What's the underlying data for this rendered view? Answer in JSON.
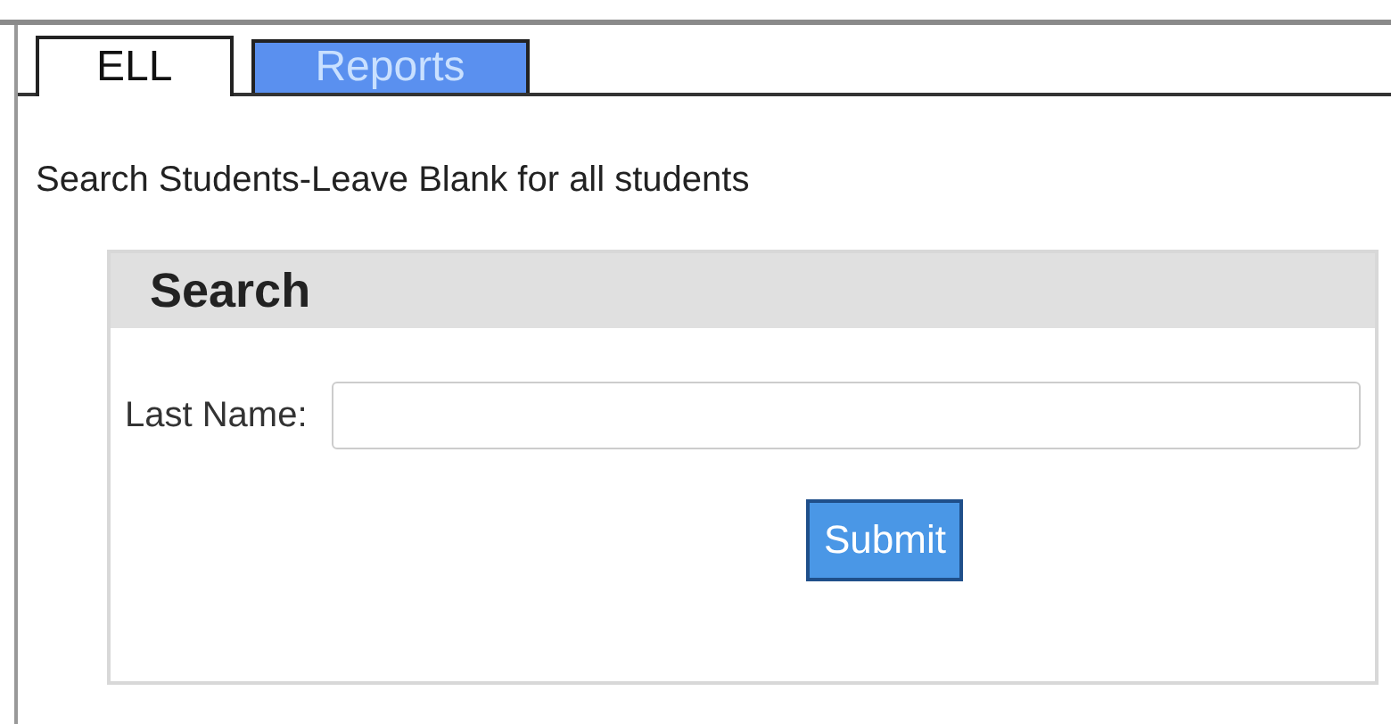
{
  "tabs": [
    {
      "label": "ELL",
      "selected": true
    },
    {
      "label": "Reports",
      "selected": false
    }
  ],
  "instructions": "Search Students-Leave Blank for all students",
  "search_panel": {
    "title": "Search",
    "fields": [
      {
        "label": "Last Name:"
      }
    ],
    "submit": "Submit"
  }
}
